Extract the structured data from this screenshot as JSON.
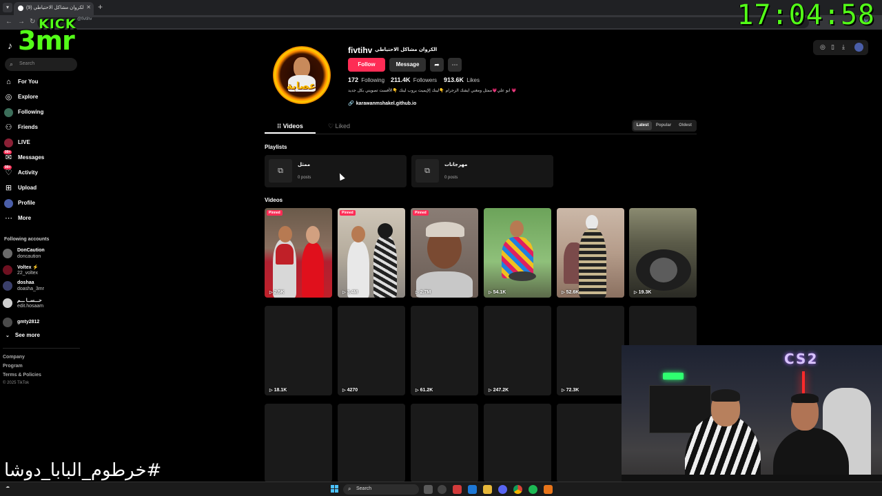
{
  "browser": {
    "tab_title": "(9) الكروان مشاكل الاحتياطي",
    "url_fragment": "@fivtihv",
    "url_right": "Ver"
  },
  "overlay": {
    "kick_top": "KICK",
    "kick_main": "3mr",
    "clock": "17:04:58",
    "hashtag": "#خرطوم_البابا_دوشا"
  },
  "sidebar": {
    "search_placeholder": "Search",
    "nav": [
      {
        "label": "For You",
        "icon": "home-icon"
      },
      {
        "label": "Explore",
        "icon": "compass-icon"
      },
      {
        "label": "Following",
        "icon": "following-avatar-icon"
      },
      {
        "label": "Friends",
        "icon": "friends-icon"
      },
      {
        "label": "LIVE",
        "icon": "live-avatar-icon"
      },
      {
        "label": "Messages",
        "icon": "messages-icon",
        "badge": "99+"
      },
      {
        "label": "Activity",
        "icon": "activity-icon",
        "badge": "99+"
      },
      {
        "label": "Upload",
        "icon": "upload-icon"
      },
      {
        "label": "Profile",
        "icon": "profile-avatar-icon"
      },
      {
        "label": "More",
        "icon": "more-dots-icon"
      }
    ],
    "following_header": "Following accounts",
    "following": [
      {
        "name": "DonCaution",
        "handle": "doncaution"
      },
      {
        "name": "Voltex ⚡",
        "handle": "22_voltex"
      },
      {
        "name": "doshaa",
        "handle": "doasha_3mr"
      },
      {
        "name": "حـــســا ـــم",
        "handle": "edit.hosaam"
      },
      {
        "name": "gmty2812",
        "handle": ""
      }
    ],
    "see_more": "See more",
    "footer": [
      "Company",
      "Program",
      "Terms & Policies"
    ],
    "copyright": "© 2025 TikTok"
  },
  "profile": {
    "username": "fivtihv",
    "nickname": "الكروان مشاكل الاحتياطي",
    "follow_label": "Follow",
    "message_label": "Message",
    "following_count": "172",
    "following_label": "Following",
    "followers_count": "211.4K",
    "followers_label": "Followers",
    "likes_count": "913.6K",
    "likes_label": "Likes",
    "bio": "ابو علي💗ممثل ومغني ايشك الزجرام 👇لينك إلإيميت يروب لينك 👇الأفست تصويني بكل جديد 💗",
    "link": "karawanmshakel.github.io"
  },
  "tabs": {
    "videos": "Videos",
    "liked": "Liked",
    "sort": [
      "Latest",
      "Popular",
      "Oldest"
    ],
    "sort_active": "Latest"
  },
  "playlists": {
    "title": "Playlists",
    "items": [
      {
        "name": "ممثل",
        "count": "0 posts"
      },
      {
        "name": "مهرجانات",
        "count": "0 posts"
      }
    ]
  },
  "videos": {
    "title": "Videos",
    "pinned_label": "Pinned",
    "row1": [
      {
        "views": "2.5K",
        "pinned": true
      },
      {
        "views": "3.4M",
        "pinned": true
      },
      {
        "views": "2.7M",
        "pinned": true
      },
      {
        "views": "54.1K",
        "pinned": false
      },
      {
        "views": "52.6K",
        "pinned": false
      },
      {
        "views": "19.3K",
        "pinned": false
      }
    ],
    "row2": [
      {
        "views": "18.1K"
      },
      {
        "views": "4270"
      },
      {
        "views": "61.2K"
      },
      {
        "views": "247.2K"
      },
      {
        "views": "72.3K"
      }
    ]
  },
  "taskbar": {
    "search_label": "Search"
  },
  "colors": {
    "accent": "#fe2c55",
    "kick_green": "#53fc18"
  }
}
